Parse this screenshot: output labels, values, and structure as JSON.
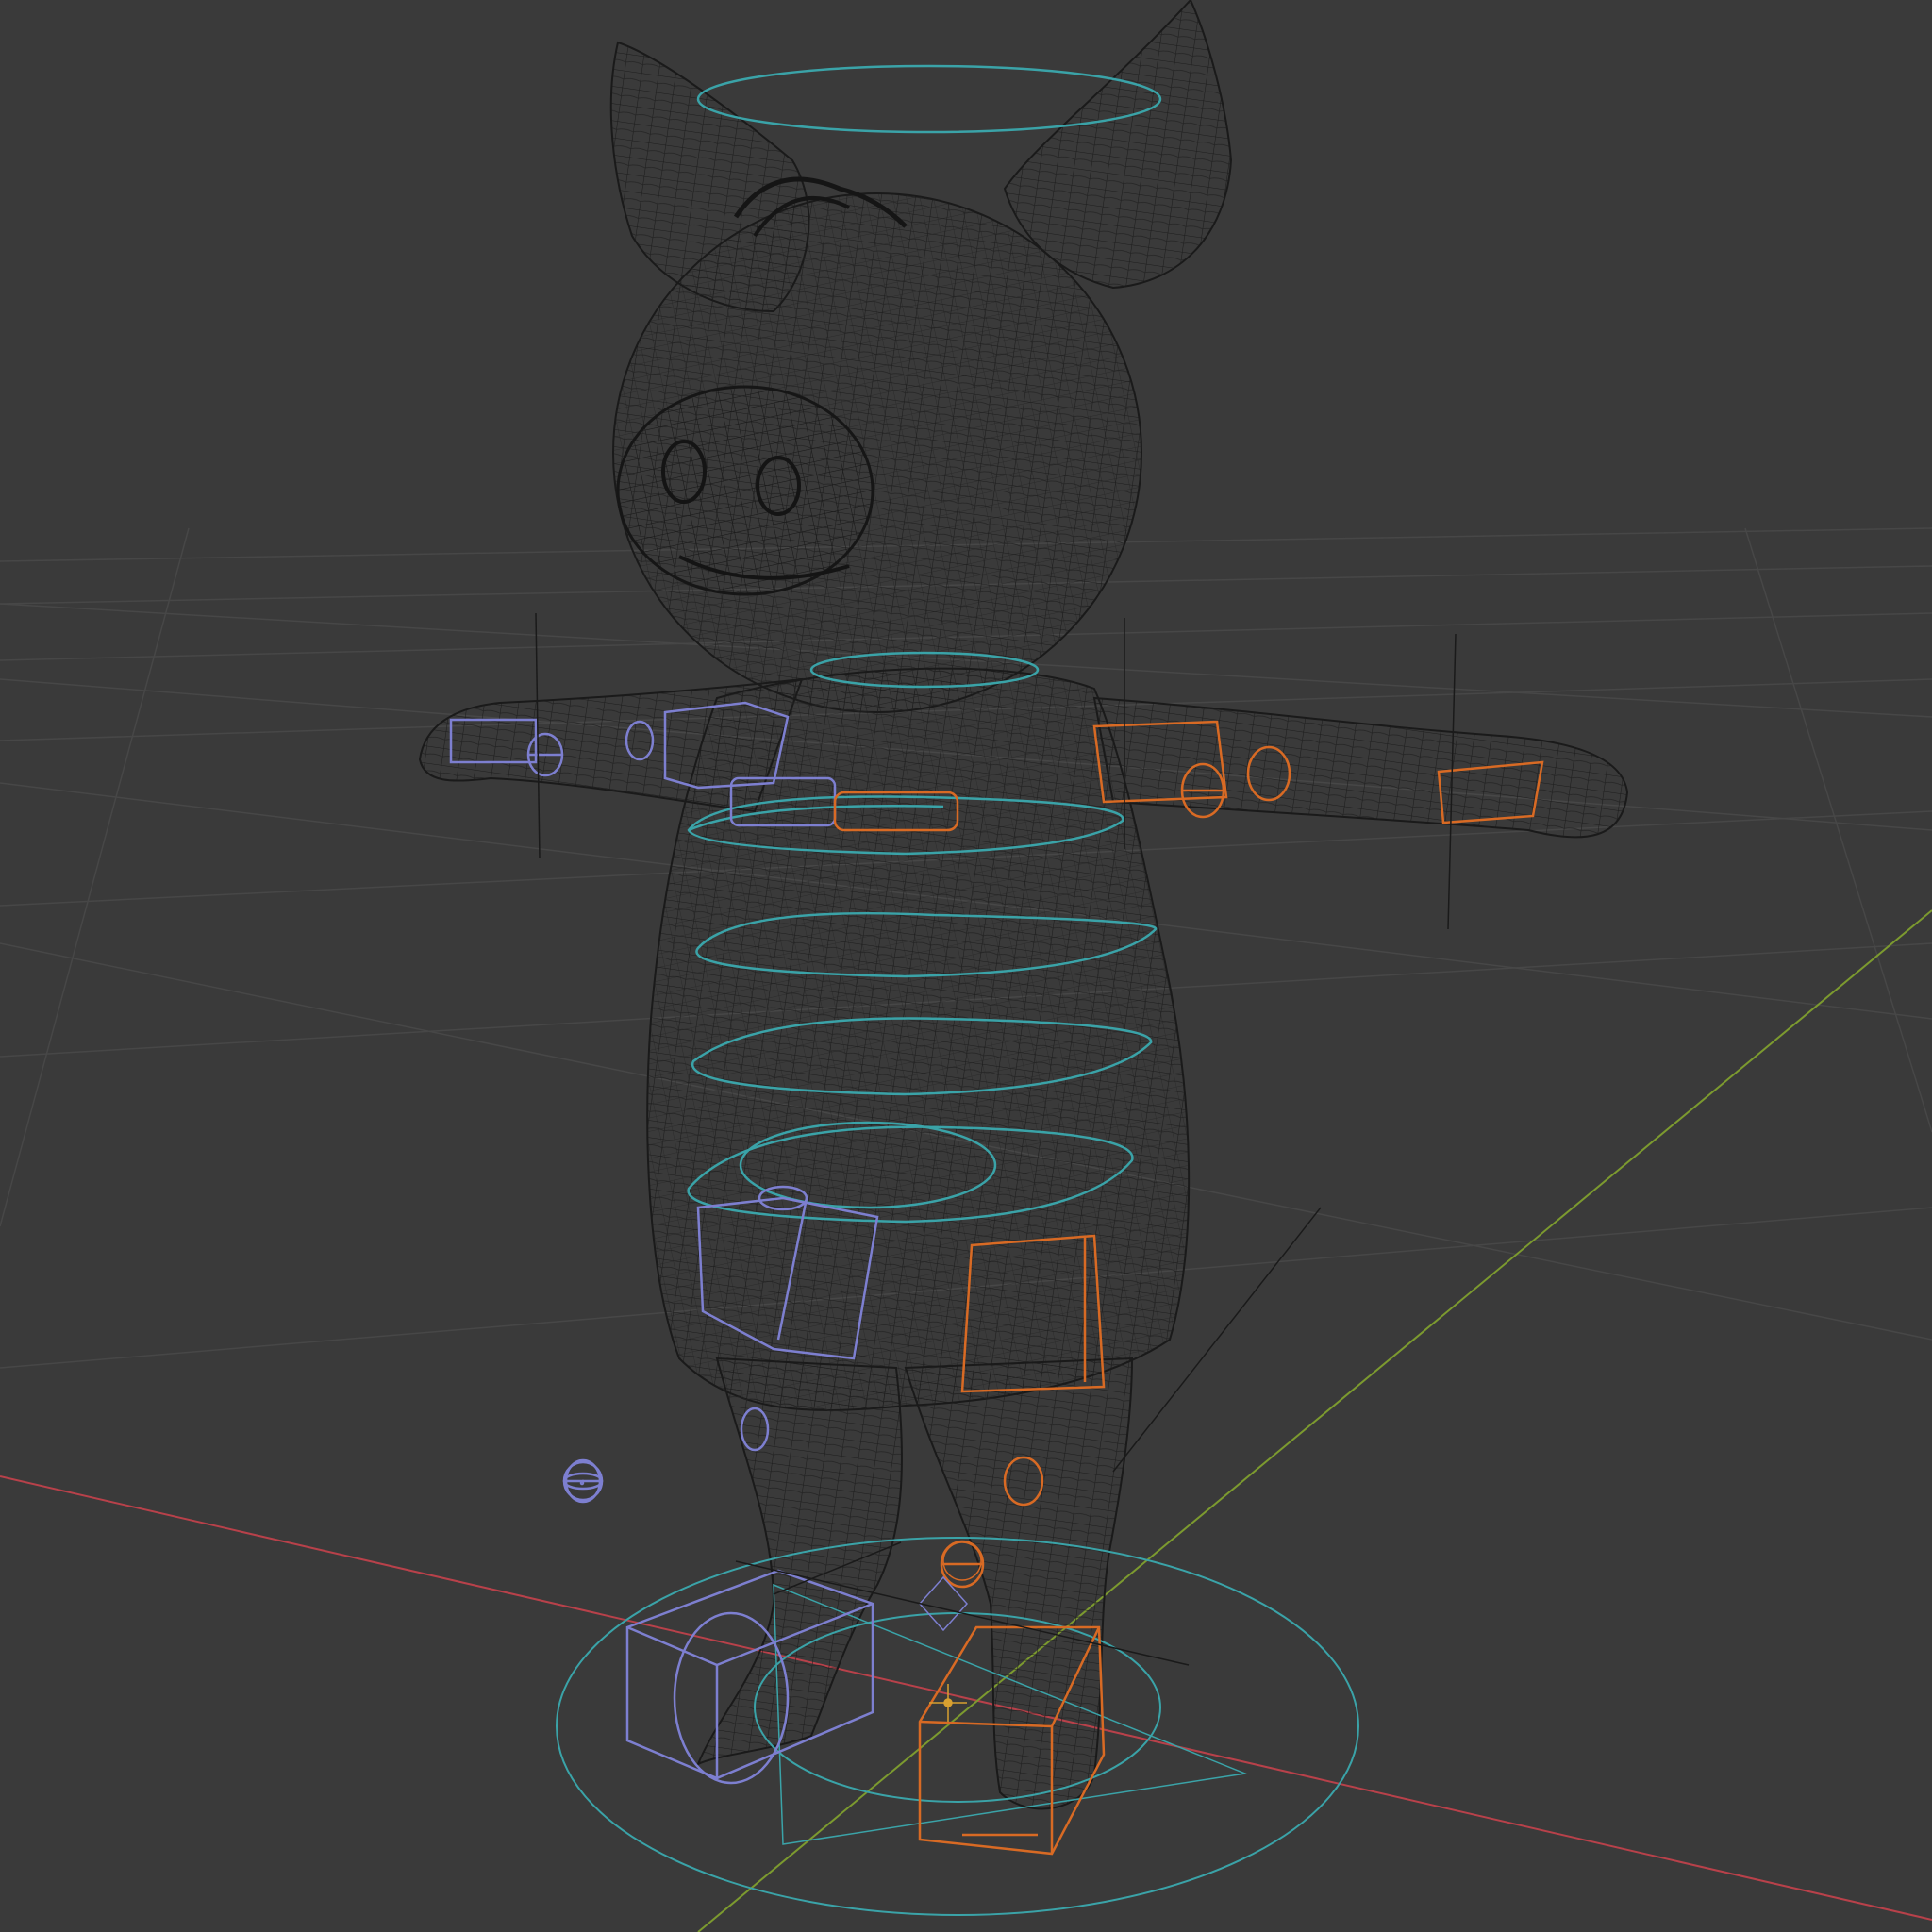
{
  "viewport": {
    "background": "#3a3a3a",
    "grid_color": "#4a4a4a",
    "x_axis_color": "#b8414a",
    "y_axis_color": "#7c9a2f",
    "mesh_color": "#1e1e1e",
    "control_color_center": "#3aa3a8",
    "control_color_left": "#7d7fd0",
    "control_color_right": "#d86a24"
  },
  "scene": {
    "character": "pig-wireframe",
    "rig": "armature-controls"
  }
}
